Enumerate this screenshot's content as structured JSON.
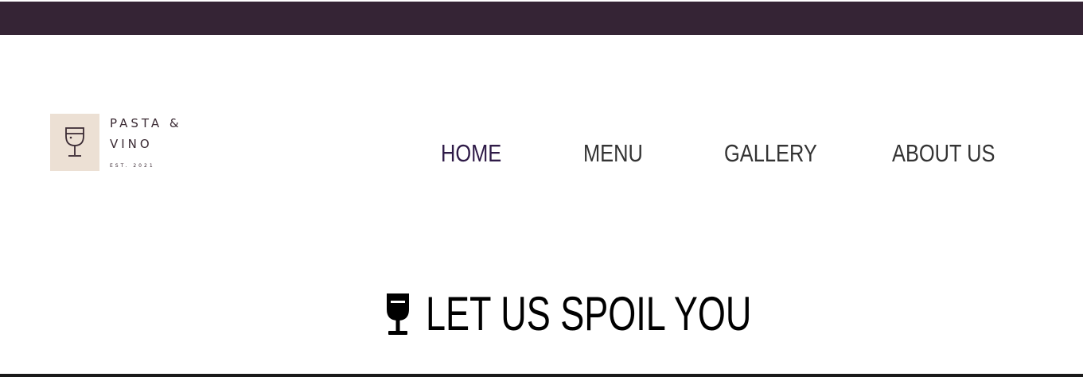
{
  "logo": {
    "line1": "PASTA &",
    "line2": "VINO",
    "est": "EST. 2021",
    "icon": "wine-glass-icon"
  },
  "nav": {
    "items": [
      {
        "label": "HOME",
        "active": true
      },
      {
        "label": "MENU",
        "active": false
      },
      {
        "label": "GALLERY",
        "active": false
      },
      {
        "label": "ABOUT US",
        "active": false
      }
    ]
  },
  "hero": {
    "title": "LET US SPOIL YOU",
    "icon": "wine-glass-icon"
  },
  "colors": {
    "top_bar": "#352435",
    "nav_active": "#2e1a47",
    "nav_default": "#333333",
    "logo_badge": "#ece0d4",
    "text_dark": "#000000"
  }
}
